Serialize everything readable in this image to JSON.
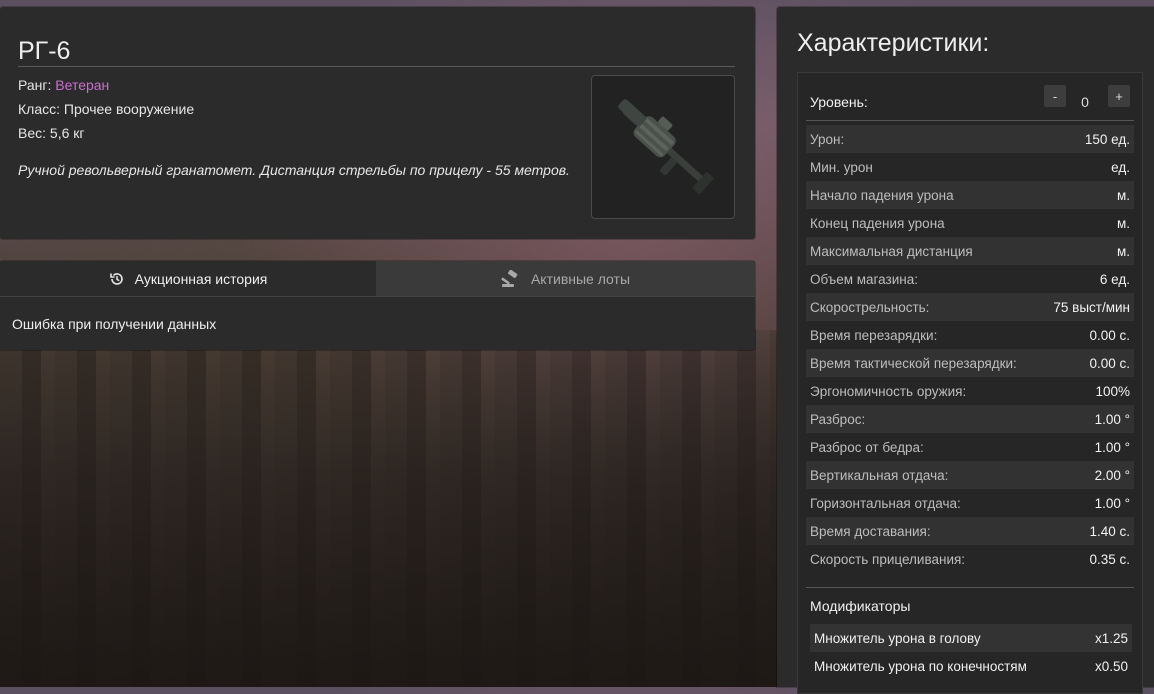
{
  "item": {
    "name": "РГ-6",
    "rank_label": "Ранг: ",
    "rank_value": "Ветеран",
    "rank_color": "#c86fcf",
    "class_line": "Класс: Прочее вооружение",
    "weight_line": "Вес: 5,6 кг",
    "description": "Ручной револьверный гранатомет. Дистанция стрельбы по прицелу - 55 метров.",
    "image_icon": "grenade-launcher-icon"
  },
  "tabs": [
    {
      "label": "Аукционная история",
      "icon": "history-icon",
      "active": true
    },
    {
      "label": "Активные лоты",
      "icon": "gavel-icon",
      "active": false
    }
  ],
  "history": {
    "error": "Ошибка при получении данных"
  },
  "stats": {
    "title": "Характеристики:",
    "level": {
      "label": "Уровень:",
      "value": "0",
      "minus": "-",
      "plus": "+"
    },
    "rows": [
      {
        "name": "Урон:",
        "value": "150 ед."
      },
      {
        "name": "Мин. урон",
        "value": "ед."
      },
      {
        "name": "Начало падения урона",
        "value": "м."
      },
      {
        "name": "Конец падения урона",
        "value": "м."
      },
      {
        "name": "Максимальная дистанция",
        "value": "м."
      },
      {
        "name": "Объем магазина:",
        "value": "6 ед."
      },
      {
        "name": "Скорострельность:",
        "value": "75 выст/мин"
      },
      {
        "name": "Время перезарядки:",
        "value": "0.00 с."
      },
      {
        "name": "Время тактической перезарядки:",
        "value": "0.00 с."
      },
      {
        "name": "Эргономичность оружия:",
        "value": "100%"
      },
      {
        "name": "Разброс:",
        "value": "1.00 °"
      },
      {
        "name": "Разброс от бедра:",
        "value": "1.00 °"
      },
      {
        "name": "Вертикальная отдача:",
        "value": "2.00 °"
      },
      {
        "name": "Горизонтальная отдача:",
        "value": "1.00 °"
      },
      {
        "name": "Время доставания:",
        "value": "1.40 с."
      },
      {
        "name": "Скорость прицеливания:",
        "value": "0.35 с."
      }
    ],
    "modifiers_title": "Модификаторы",
    "modifiers": [
      {
        "name": "Множитель урона в голову",
        "value": "x1.25"
      },
      {
        "name": "Множитель урона по конечностям",
        "value": "x0.50"
      }
    ]
  }
}
